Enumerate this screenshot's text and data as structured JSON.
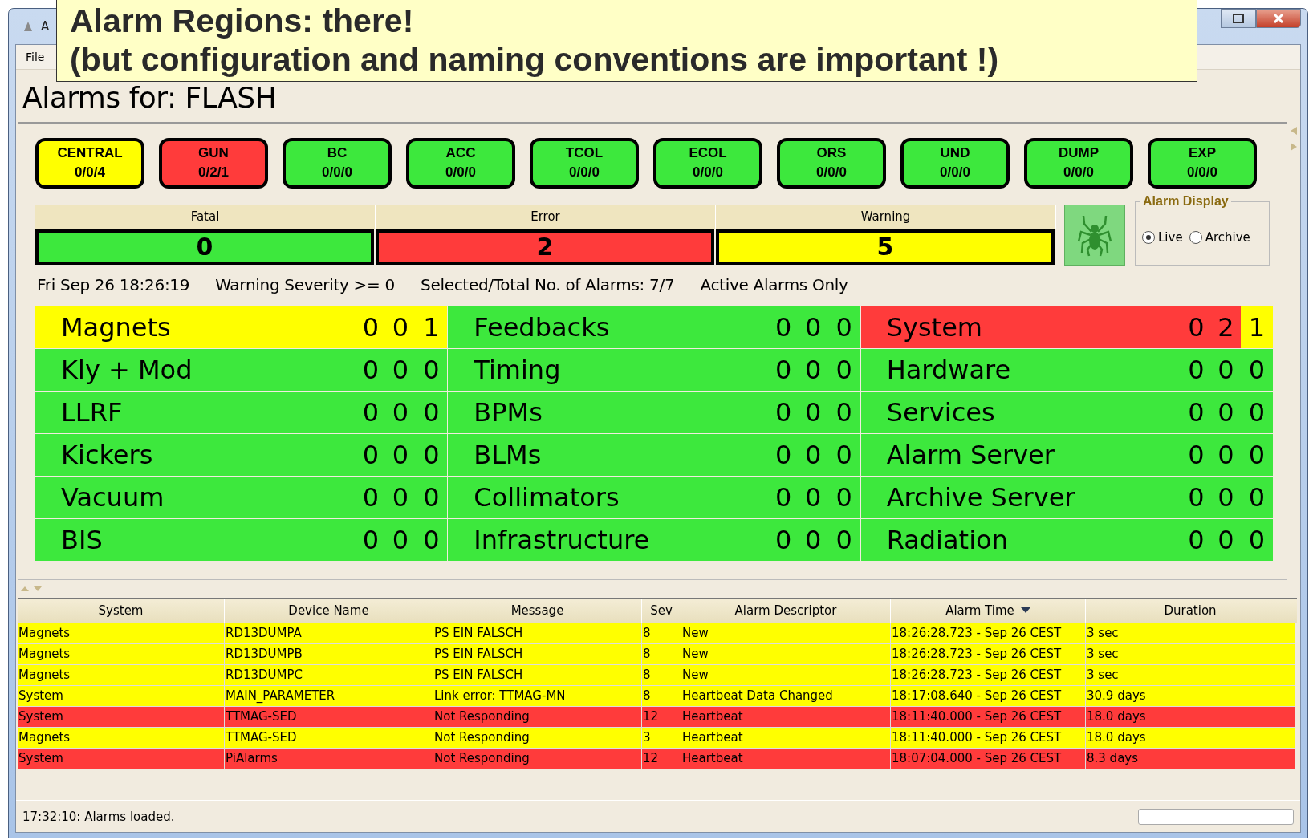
{
  "callout": {
    "lines": [
      "Alarm Regions: there!",
      "(but configuration and naming conventions are important !)"
    ]
  },
  "window": {
    "title": "A"
  },
  "menu": [
    "File"
  ],
  "heading": "Alarms for: FLASH",
  "regions": [
    {
      "label": "CENTRAL",
      "counts": "0/0/4",
      "color": "#ffff00"
    },
    {
      "label": "GUN",
      "counts": "0/2/1",
      "color": "#ff3b3b"
    },
    {
      "label": "BC",
      "counts": "0/0/0",
      "color": "#3de83d"
    },
    {
      "label": "ACC",
      "counts": "0/0/0",
      "color": "#3de83d"
    },
    {
      "label": "TCOL",
      "counts": "0/0/0",
      "color": "#3de83d"
    },
    {
      "label": "ECOL",
      "counts": "0/0/0",
      "color": "#3de83d"
    },
    {
      "label": "ORS",
      "counts": "0/0/0",
      "color": "#3de83d"
    },
    {
      "label": "UND",
      "counts": "0/0/0",
      "color": "#3de83d"
    },
    {
      "label": "DUMP",
      "counts": "0/0/0",
      "color": "#3de83d"
    },
    {
      "label": "EXP",
      "counts": "0/0/0",
      "color": "#3de83d"
    }
  ],
  "severity": [
    {
      "label": "Fatal",
      "count": "0",
      "color": "#3de83d"
    },
    {
      "label": "Error",
      "count": "2",
      "color": "#ff3b3b"
    },
    {
      "label": "Warning",
      "count": "5",
      "color": "#ffff00"
    }
  ],
  "alarm_display": {
    "title": "Alarm Display",
    "options": [
      {
        "label": "Live",
        "selected": true
      },
      {
        "label": "Archive",
        "selected": false
      }
    ]
  },
  "info_line": [
    "Fri Sep 26 18:26:19",
    "Warning Severity >= 0",
    "Selected/Total No. of Alarms: 7/7",
    "Active Alarms Only"
  ],
  "grid": [
    {
      "name": "Magnets",
      "counts": [
        "0",
        "0",
        "1"
      ],
      "color": "#ffff00"
    },
    {
      "name": "Feedbacks",
      "counts": [
        "0",
        "0",
        "0"
      ],
      "color": "#3de83d"
    },
    {
      "name": "System",
      "counts": [
        {
          "value": "0",
          "color": "#ff3b3b"
        },
        {
          "value": "2",
          "color": "#ff3b3b"
        },
        {
          "value": "1",
          "color": "#ffff00"
        }
      ],
      "color": "#ff3b3b"
    },
    {
      "name": "Kly + Mod",
      "counts": [
        "0",
        "0",
        "0"
      ],
      "color": "#3de83d"
    },
    {
      "name": "Timing",
      "counts": [
        "0",
        "0",
        "0"
      ],
      "color": "#3de83d"
    },
    {
      "name": "Hardware",
      "counts": [
        "0",
        "0",
        "0"
      ],
      "color": "#3de83d"
    },
    {
      "name": "LLRF",
      "counts": [
        "0",
        "0",
        "0"
      ],
      "color": "#3de83d"
    },
    {
      "name": "BPMs",
      "counts": [
        "0",
        "0",
        "0"
      ],
      "color": "#3de83d"
    },
    {
      "name": "Services",
      "counts": [
        "0",
        "0",
        "0"
      ],
      "color": "#3de83d"
    },
    {
      "name": "Kickers",
      "counts": [
        "0",
        "0",
        "0"
      ],
      "color": "#3de83d"
    },
    {
      "name": "BLMs",
      "counts": [
        "0",
        "0",
        "0"
      ],
      "color": "#3de83d"
    },
    {
      "name": "Alarm Server",
      "counts": [
        "0",
        "0",
        "0"
      ],
      "color": "#3de83d"
    },
    {
      "name": "Vacuum",
      "counts": [
        "0",
        "0",
        "0"
      ],
      "color": "#3de83d"
    },
    {
      "name": "Collimators",
      "counts": [
        "0",
        "0",
        "0"
      ],
      "color": "#3de83d"
    },
    {
      "name": "Archive Server",
      "counts": [
        "0",
        "0",
        "0"
      ],
      "color": "#3de83d"
    },
    {
      "name": "BIS",
      "counts": [
        "0",
        "0",
        "0"
      ],
      "color": "#3de83d"
    },
    {
      "name": "Infrastructure",
      "counts": [
        "0",
        "0",
        "0"
      ],
      "color": "#3de83d"
    },
    {
      "name": "Radiation",
      "counts": [
        "0",
        "0",
        "0"
      ],
      "color": "#3de83d"
    }
  ],
  "table": {
    "columns": [
      {
        "label": "System",
        "sorted": false
      },
      {
        "label": "Device Name",
        "sorted": false
      },
      {
        "label": "Message",
        "sorted": false
      },
      {
        "label": "Sev",
        "sorted": false
      },
      {
        "label": "Alarm Descriptor",
        "sorted": false
      },
      {
        "label": "Alarm Time",
        "sorted": true
      },
      {
        "label": "Duration",
        "sorted": false
      }
    ],
    "rows": [
      {
        "color": "#ffff00",
        "cells": [
          "Magnets",
          "RD13DUMPA",
          "PS EIN FALSCH",
          "8",
          "New",
          "18:26:28.723 - Sep 26 CEST",
          "3 sec"
        ]
      },
      {
        "color": "#ffff00",
        "cells": [
          "Magnets",
          "RD13DUMPB",
          "PS EIN FALSCH",
          "8",
          "New",
          "18:26:28.723 - Sep 26 CEST",
          "3 sec"
        ]
      },
      {
        "color": "#ffff00",
        "cells": [
          "Magnets",
          "RD13DUMPC",
          "PS EIN FALSCH",
          "8",
          "New",
          "18:26:28.723 - Sep 26 CEST",
          "3 sec"
        ]
      },
      {
        "color": "#ffff00",
        "cells": [
          "System",
          "MAIN_PARAMETER",
          "Link error: TTMAG-MN",
          "8",
          "Heartbeat Data Changed",
          "18:17:08.640 - Sep 26 CEST",
          "30.9 days"
        ]
      },
      {
        "color": "#ff3b3b",
        "cells": [
          "System",
          "TTMAG-SED",
          "Not Responding",
          "12",
          "Heartbeat",
          "18:11:40.000 - Sep 26 CEST",
          "18.0 days"
        ]
      },
      {
        "color": "#ffff00",
        "cells": [
          "Magnets",
          "TTMAG-SED",
          "Not Responding",
          "3",
          "Heartbeat",
          "18:11:40.000 - Sep 26 CEST",
          "18.0 days"
        ]
      },
      {
        "color": "#ff3b3b",
        "cells": [
          "System",
          "PiAlarms",
          "Not Responding",
          "12",
          "Heartbeat",
          "18:07:04.000 - Sep 26 CEST",
          "8.3 days"
        ]
      }
    ]
  },
  "status_bar": {
    "message": "17:32:10: Alarms loaded.",
    "progress": {
      "level": 0
    }
  }
}
